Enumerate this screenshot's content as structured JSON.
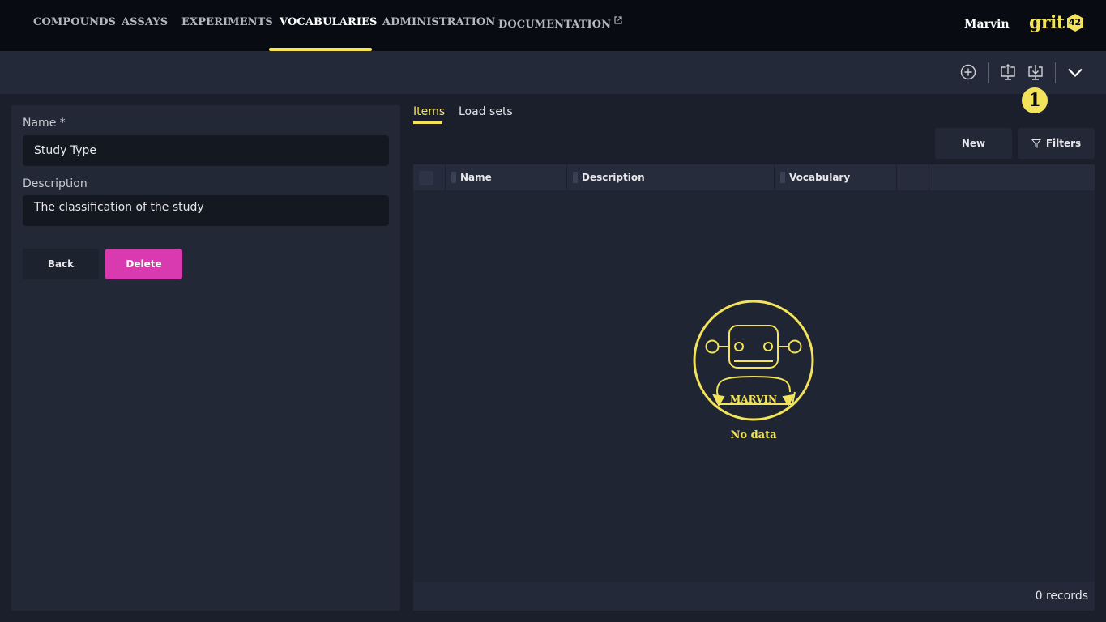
{
  "nav": {
    "items": [
      "COMPOUNDS",
      "ASSAYS",
      "EXPERIMENTS",
      "VOCABULARIES",
      "ADMINISTRATION",
      "DOCUMENTATION"
    ],
    "active": "VOCABULARIES",
    "user": "Marvin",
    "logo_text": "grit",
    "logo_number": "42"
  },
  "toolbar": {
    "icons": [
      "plus-circle-icon",
      "upload-icon",
      "download-icon",
      "chevron-down-icon"
    ],
    "badge": "1"
  },
  "form": {
    "name_label": "Name *",
    "name_value": "Study Type",
    "description_label": "Description",
    "description_value": "The classification of the study",
    "back_label": "Back",
    "delete_label": "Delete"
  },
  "tabs": [
    "Items",
    "Load sets"
  ],
  "grid": {
    "new_label": "New",
    "filters_label": "Filters",
    "columns": [
      "Name",
      "Description",
      "Vocabulary"
    ],
    "empty_label": "MARVIN",
    "empty_text": "No data",
    "records": "0 records"
  },
  "colors": {
    "accent": "#f2e35a",
    "danger": "#d93ab0",
    "nav_bg": "#090b13",
    "panel_bg": "#222836"
  }
}
